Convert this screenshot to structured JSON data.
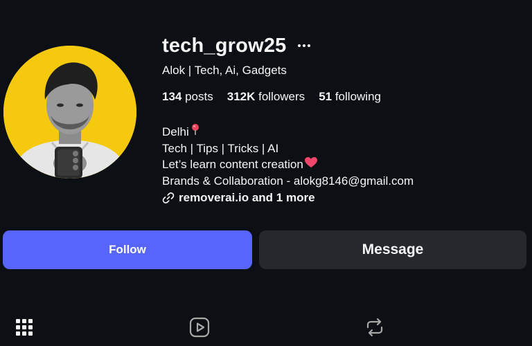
{
  "profile": {
    "username": "tech_grow25",
    "full_name": "Alok | Tech, Ai, Gadgets",
    "stats": {
      "posts_count": "134",
      "posts_label": " posts",
      "followers_count": "312K",
      "followers_label": " followers",
      "following_count": "51",
      "following_label": " following"
    },
    "bio": {
      "line1": "Delhi",
      "line2": "Tech | Tips | Tricks | AI",
      "line3": "Let’s learn content creation",
      "line4": "Brands & Collaboration - alokg8146@gmail.com"
    },
    "link_text": "removerai.io and 1 more"
  },
  "actions": {
    "follow_label": "Follow",
    "message_label": "Message"
  },
  "icons": {
    "more": "more-options-icon",
    "pin": "round-pushpin-icon",
    "heart": "heart-icon",
    "link": "link-icon",
    "grid": "grid-icon",
    "reels": "reels-icon",
    "reposts": "repost-icon"
  },
  "colors": {
    "background": "#0c1014",
    "text": "#f5f5f5",
    "follow_button": "#5865fc",
    "message_button": "#25292e",
    "avatar_background": "#f5c90e",
    "heart": "#f0466b",
    "pin": "#e8455a"
  }
}
